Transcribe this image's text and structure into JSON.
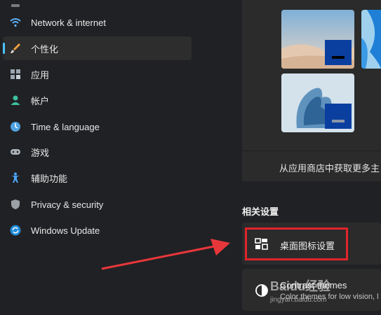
{
  "sidebar": {
    "items": [
      {
        "label": "Network & internet",
        "icon": "wifi-icon",
        "active": false
      },
      {
        "label": "个性化",
        "icon": "paintbrush-icon",
        "active": true
      },
      {
        "label": "应用",
        "icon": "apps-icon",
        "active": false
      },
      {
        "label": "帐户",
        "icon": "person-icon",
        "active": false
      },
      {
        "label": "Time & language",
        "icon": "globe-clock-icon",
        "active": false
      },
      {
        "label": "游戏",
        "icon": "gamepad-icon",
        "active": false
      },
      {
        "label": "辅助功能",
        "icon": "accessibility-icon",
        "active": false
      },
      {
        "label": "Privacy & security",
        "icon": "shield-icon",
        "active": false
      },
      {
        "label": "Windows Update",
        "icon": "update-icon",
        "active": false
      }
    ]
  },
  "themes": {
    "store_link": "从应用商店中获取更多主"
  },
  "related_settings": {
    "title": "相关设置",
    "desktop_icons": {
      "title": "桌面图标设置",
      "icon": "desktop-icons-icon"
    },
    "contrast_themes": {
      "title": "Contrast themes",
      "subtitle": "Color themes for low vision, l",
      "icon": "contrast-icon"
    }
  },
  "watermark": {
    "text": "Baidu经验",
    "url": "jingyan.baidu.com"
  },
  "colors": {
    "accent": "#4cc2ff",
    "highlight": "#e1242b",
    "arrow": "#e8373b"
  }
}
